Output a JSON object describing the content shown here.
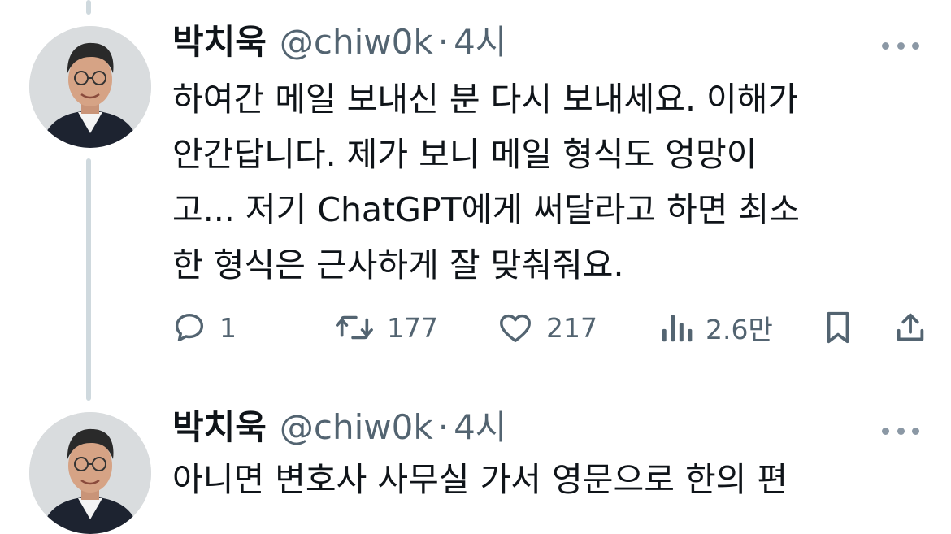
{
  "tweets": [
    {
      "author_name": "박치욱",
      "handle": "@chiw0k",
      "separator": "·",
      "time": "4시",
      "text": "하여간 메일 보내신 분 다시 보내세요. 이해가\n안간답니다. 제가 보니 메일 형식도 엉망이\n고... 저기 ChatGPT에게 써달라고 하면 최소\n한 형식은 근사하게 잘 맞춰줘요.",
      "actions": {
        "replies": "1",
        "retweets": "177",
        "likes": "217",
        "views": "2.6만"
      },
      "icons": [
        "reply-icon",
        "retweet-icon",
        "like-icon",
        "views-icon",
        "bookmark-icon",
        "share-icon",
        "more-icon"
      ]
    },
    {
      "author_name": "박치욱",
      "handle": "@chiw0k",
      "separator": "·",
      "time": "4시",
      "text": "아니면 변호사 사무실 가서 영문으로 한의 편"
    }
  ],
  "colors": {
    "text": "#0f1419",
    "secondary": "#536471",
    "thread_line": "#cfd9de"
  }
}
